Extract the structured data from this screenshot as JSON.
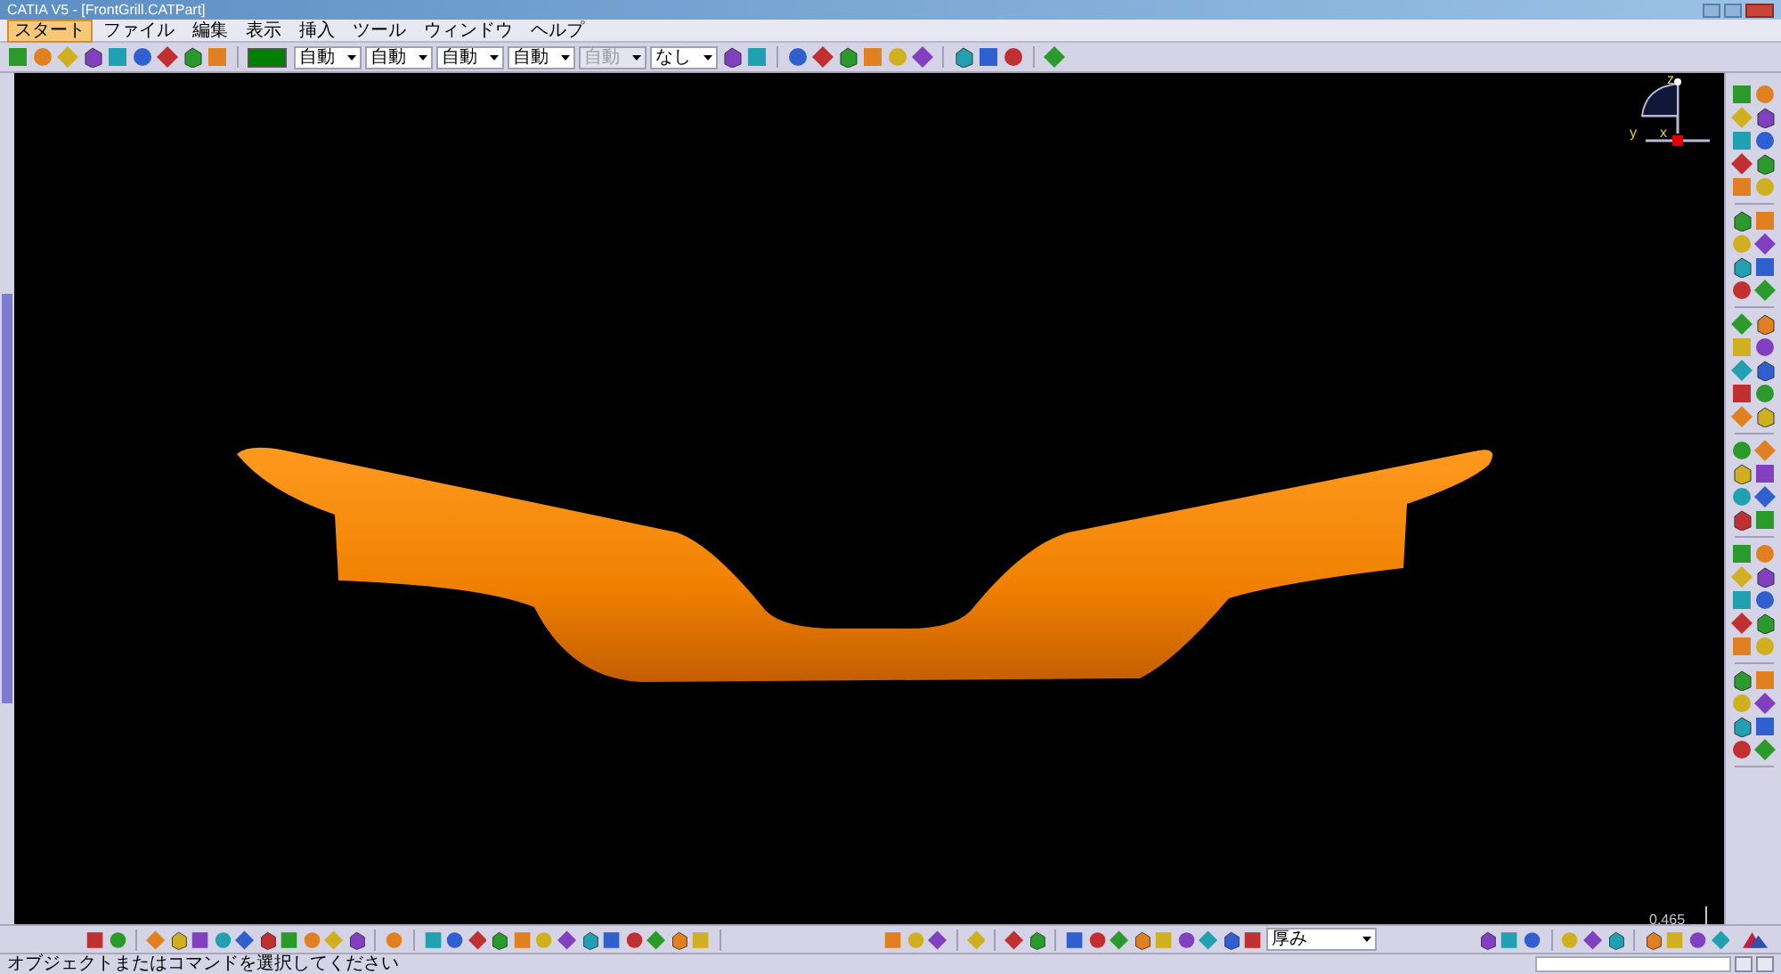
{
  "window": {
    "title": "CATIA V5 - [FrontGrill.CATPart]"
  },
  "menu": [
    {
      "label": "スタート",
      "selected": true
    },
    {
      "label": "ファイル",
      "selected": false
    },
    {
      "label": "編集",
      "selected": false
    },
    {
      "label": "表示",
      "selected": false
    },
    {
      "label": "挿入",
      "selected": false
    },
    {
      "label": "ツール",
      "selected": false
    },
    {
      "label": "ウィンドウ",
      "selected": false
    },
    {
      "label": "ヘルプ",
      "selected": false
    }
  ],
  "properties_toolbar": {
    "color": "#008000",
    "dropdowns": [
      {
        "value": "自動",
        "disabled": false
      },
      {
        "value": "自動",
        "disabled": false
      },
      {
        "value": "自動",
        "disabled": false
      },
      {
        "value": "自動",
        "disabled": false
      },
      {
        "value": "自動",
        "disabled": true
      },
      {
        "value": "なし",
        "disabled": false
      }
    ]
  },
  "compass": {
    "axes": [
      "z",
      "y",
      "x"
    ]
  },
  "scale_readout": "0.465",
  "view_toolbar": {
    "dropdown": "厚み"
  },
  "status_bar": {
    "message": "オブジェクトまたはコマンドを選択してください"
  }
}
